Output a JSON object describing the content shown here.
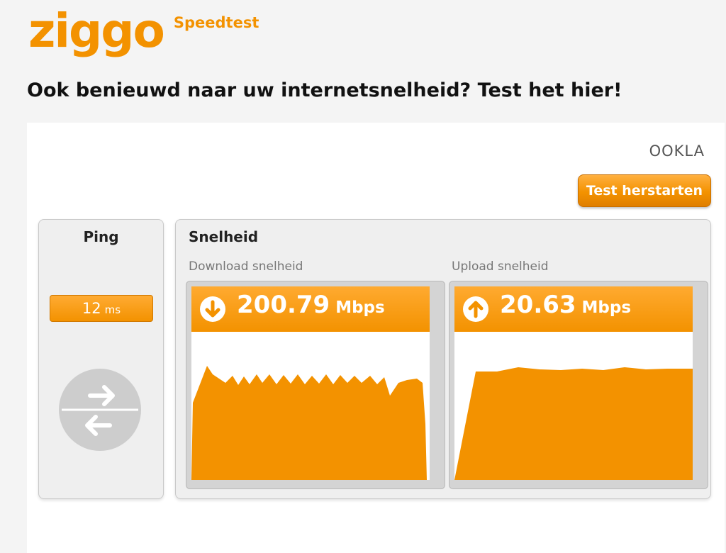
{
  "header": {
    "logo_text": "ziggo",
    "logo_subtitle": "Speedtest",
    "headline": "Ook benieuwd naar uw internetsnelheid? Test het hier!"
  },
  "widget": {
    "provider_logo": "OOKLA",
    "restart_label": "Test herstarten",
    "ping": {
      "title": "Ping",
      "value": "12",
      "unit": "ms",
      "icon": "ping-arrows-icon"
    },
    "speed": {
      "title": "Snelheid",
      "download": {
        "label": "Download snelheid",
        "value": "200.79",
        "unit": "Mbps",
        "icon": "download-arrow-icon"
      },
      "upload": {
        "label": "Upload snelheid",
        "value": "20.63",
        "unit": "Mbps",
        "icon": "upload-arrow-icon"
      }
    }
  },
  "colors": {
    "brand_orange": "#f39200",
    "graph_fill": "#f39200",
    "background": "#f4f4f4"
  }
}
